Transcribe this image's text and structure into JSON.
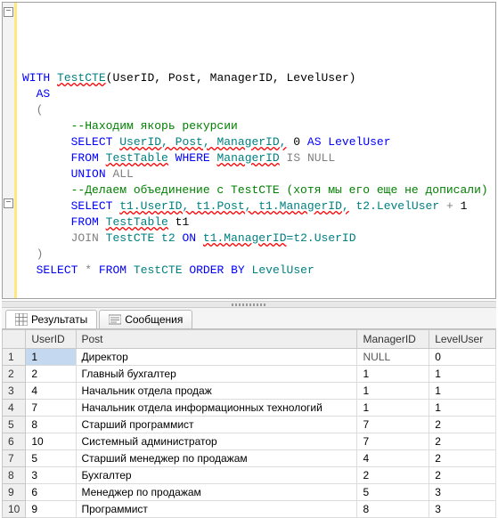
{
  "code": {
    "l1": {
      "kw1": "WITH",
      "name": "TestCTE",
      "plain": "(UserID, Post, ManagerID, LevelUser)"
    },
    "l2": "AS",
    "l3": "(",
    "c1": "--Находим якорь рекурсии",
    "l4": {
      "select": "SELECT",
      "cols": "UserID, Post, ManagerID,",
      "zero": "0",
      "asLevel": "AS LevelUser"
    },
    "l5": {
      "from": "FROM",
      "tbl": "TestTable",
      "where": "WHERE",
      "col": "ManagerID",
      "is": "IS",
      "null": "NULL"
    },
    "l6": {
      "union": "UNION",
      "all": "ALL"
    },
    "c2": "--Делаем объединение с TestCTE (хотя мы его еще не дописали)",
    "l7": {
      "select": "SELECT",
      "cols": "t1.UserID, t1.Post, t1.ManagerID,",
      "t2": "t2.LevelUser",
      "plus": "+",
      "one": "1"
    },
    "l8": {
      "from": "FROM",
      "tbl": "TestTable",
      "alias": "t1"
    },
    "l9": {
      "join": "JOIN",
      "cte": "TestCTE t2",
      "on": "ON",
      "left": "t1.ManagerID",
      "right": "=t2.UserID"
    },
    "l10": ")",
    "l11": {
      "select": "SELECT",
      "star": "*",
      "from": "FROM",
      "tbl": "TestCTE",
      "order": "ORDER BY",
      "col": "LevelUser"
    }
  },
  "tabs": {
    "results": "Результаты",
    "messages": "Сообщения"
  },
  "columns": [
    "UserID",
    "Post",
    "ManagerID",
    "LevelUser"
  ],
  "rows": [
    {
      "UserID": "1",
      "Post": "Директор",
      "ManagerID": "NULL",
      "LevelUser": "0"
    },
    {
      "UserID": "2",
      "Post": "Главный бухгалтер",
      "ManagerID": "1",
      "LevelUser": "1"
    },
    {
      "UserID": "4",
      "Post": "Начальник отдела продаж",
      "ManagerID": "1",
      "LevelUser": "1"
    },
    {
      "UserID": "7",
      "Post": "Начальник отдела информационных технологий",
      "ManagerID": "1",
      "LevelUser": "1"
    },
    {
      "UserID": "8",
      "Post": "Старший программист",
      "ManagerID": "7",
      "LevelUser": "2"
    },
    {
      "UserID": "10",
      "Post": "Системный администратор",
      "ManagerID": "7",
      "LevelUser": "2"
    },
    {
      "UserID": "5",
      "Post": "Старший менеджер по продажам",
      "ManagerID": "4",
      "LevelUser": "2"
    },
    {
      "UserID": "3",
      "Post": "Бухгалтер",
      "ManagerID": "2",
      "LevelUser": "2"
    },
    {
      "UserID": "6",
      "Post": "Менеджер по продажам",
      "ManagerID": "5",
      "LevelUser": "3"
    },
    {
      "UserID": "9",
      "Post": "Программист",
      "ManagerID": "8",
      "LevelUser": "3"
    }
  ],
  "chart_data": {
    "type": "table",
    "title": "Результаты",
    "columns": [
      "UserID",
      "Post",
      "ManagerID",
      "LevelUser"
    ],
    "rows": [
      [
        1,
        "Директор",
        null,
        0
      ],
      [
        2,
        "Главный бухгалтер",
        1,
        1
      ],
      [
        4,
        "Начальник отдела продаж",
        1,
        1
      ],
      [
        7,
        "Начальник отдела информационных технологий",
        1,
        1
      ],
      [
        8,
        "Старший программист",
        7,
        2
      ],
      [
        10,
        "Системный администратор",
        7,
        2
      ],
      [
        5,
        "Старший менеджер по продажам",
        4,
        2
      ],
      [
        3,
        "Бухгалтер",
        2,
        2
      ],
      [
        6,
        "Менеджер по продажам",
        5,
        3
      ],
      [
        9,
        "Программист",
        8,
        3
      ]
    ]
  }
}
